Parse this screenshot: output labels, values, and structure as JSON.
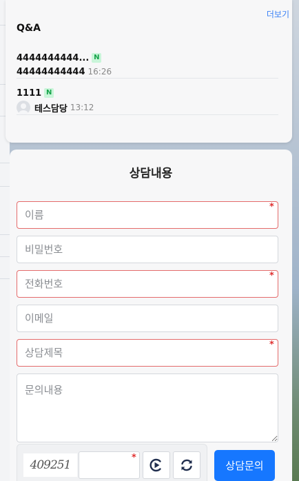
{
  "qa": {
    "title": "Q&A",
    "more_label": "더보기",
    "items": [
      {
        "title": "4444444444...",
        "badge": "N",
        "subtitle": "44444444444",
        "time": "16:26",
        "has_avatar": false
      },
      {
        "title": "1111",
        "badge": "N",
        "subtitle": "테스담당",
        "time": "13:12",
        "has_avatar": true
      }
    ]
  },
  "form": {
    "title": "상담내용",
    "fields": {
      "name": {
        "placeholder": "이름",
        "required": true,
        "required_mark": "*"
      },
      "password": {
        "placeholder": "비밀번호",
        "required": false
      },
      "phone": {
        "placeholder": "전화번호",
        "required": true,
        "required_mark": "*"
      },
      "email": {
        "placeholder": "이메일",
        "required": false
      },
      "subject": {
        "placeholder": "상담제목",
        "required": true,
        "required_mark": "*"
      },
      "content": {
        "placeholder": "문의내용",
        "required": false
      }
    },
    "captcha": {
      "image_text": "409251",
      "required_mark": "*",
      "audio_icon": "play-audio-icon",
      "refresh_icon": "refresh-icon"
    },
    "submit_label": "상담문의"
  },
  "colors": {
    "accent": "#1677ff",
    "required_border": "#e46a6a",
    "required_star": "#e03131",
    "badge_bg": "#c9f5d9",
    "badge_text": "#16a34a",
    "link": "#3b82f6"
  }
}
